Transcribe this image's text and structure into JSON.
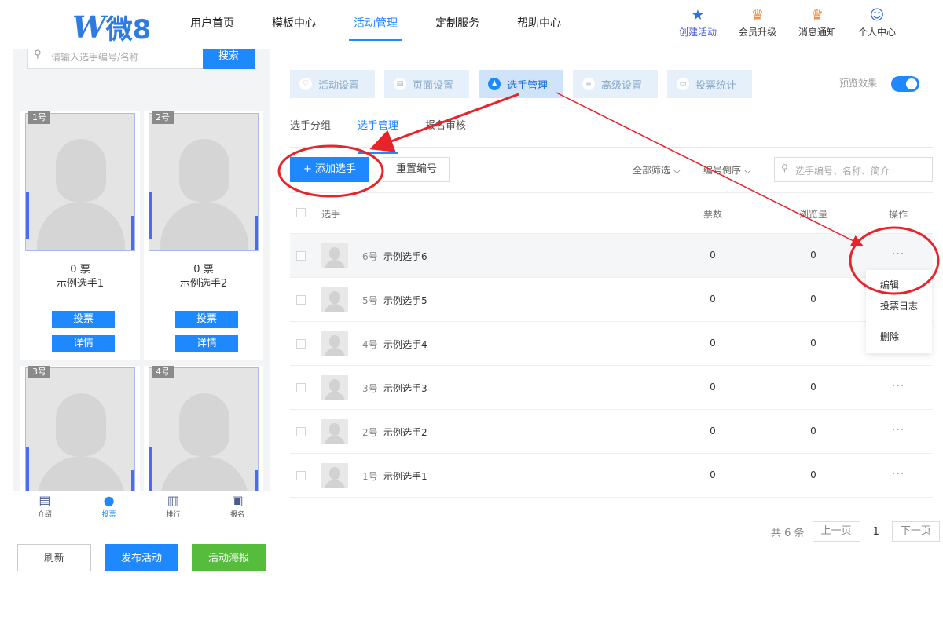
{
  "logo": {
    "mark": "W",
    "text": "微8"
  },
  "nav": [
    "用户首页",
    "模板中心",
    "活动管理",
    "定制服务",
    "帮助中心"
  ],
  "header_actions": [
    {
      "label": "创建活动",
      "icon": "star-icon"
    },
    {
      "label": "会员升级",
      "icon": "crown-icon"
    },
    {
      "label": "消息通知",
      "icon": "bell-icon"
    },
    {
      "label": "个人中心",
      "icon": "user-icon"
    }
  ],
  "preview_phone": {
    "search_placeholder": "请输入选手编号/名称",
    "search_button": "搜索",
    "cards": [
      {
        "num": "1号",
        "votes": "0 票",
        "name": "示例选手1"
      },
      {
        "num": "2号",
        "votes": "0 票",
        "name": "示例选手2"
      },
      {
        "num": "3号"
      },
      {
        "num": "4号"
      }
    ],
    "vote_label": "投票",
    "detail_label": "详情",
    "tabbar": [
      "介绍",
      "投票",
      "排行",
      "报名"
    ]
  },
  "bottom_buttons": {
    "refresh": "刷新",
    "publish": "发布活动",
    "poster": "活动海报"
  },
  "steps": [
    "活动设置",
    "页面设置",
    "选手管理",
    "高级设置",
    "投票统计"
  ],
  "preview_label": "预览效果",
  "subtabs": [
    "选手分组",
    "选手管理",
    "报名审核"
  ],
  "toolbar": {
    "add": "+ 添加选手",
    "reset": "重置编号",
    "filter_all": "全部筛选 ⌵",
    "filter_order": "编号倒序 ⌵",
    "search_placeholder": "选手编号、名称、简介"
  },
  "table": {
    "headers": {
      "name": "选手",
      "votes": "票数",
      "views": "浏览量",
      "ops": "操作"
    },
    "rows": [
      {
        "num": "6号",
        "name": "示例选手6",
        "votes": "0",
        "views": "0",
        "ops": "···"
      },
      {
        "num": "5号",
        "name": "示例选手5",
        "votes": "0",
        "views": "0",
        "ops": "···"
      },
      {
        "num": "4号",
        "name": "示例选手4",
        "votes": "0",
        "views": "0",
        "ops": "···"
      },
      {
        "num": "3号",
        "name": "示例选手3",
        "votes": "0",
        "views": "0",
        "ops": "···"
      },
      {
        "num": "2号",
        "name": "示例选手2",
        "votes": "0",
        "views": "0",
        "ops": "···"
      },
      {
        "num": "1号",
        "name": "示例选手1",
        "votes": "0",
        "views": "0",
        "ops": "···"
      }
    ]
  },
  "dropdown": [
    "编辑",
    "投票日志",
    "删除"
  ],
  "pager": {
    "total": "共 6 条",
    "prev": "上一页",
    "current": "1",
    "next": "下一页"
  },
  "colors": {
    "primary": "#1e88ff",
    "annotation": "#e8232a",
    "green": "#55bd3b"
  }
}
